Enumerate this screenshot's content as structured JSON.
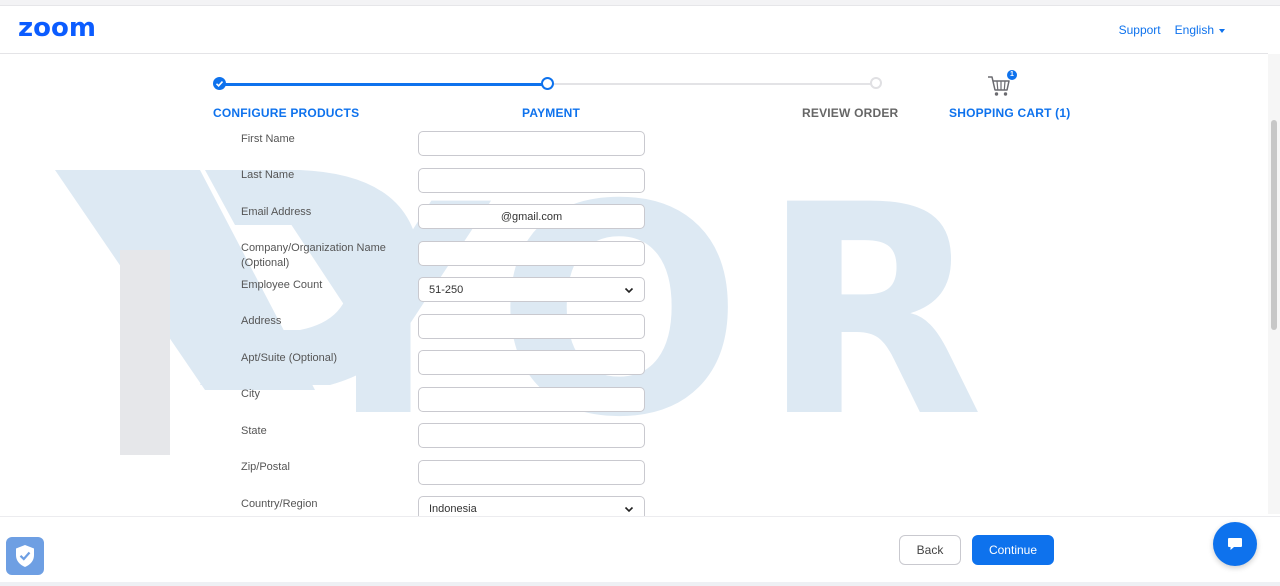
{
  "header": {
    "logo": "zoom",
    "support_label": "Support",
    "language_label": "English"
  },
  "watermark": {
    "text": "YOR"
  },
  "stepper": {
    "steps": [
      {
        "label": "CONFIGURE PRODUCTS",
        "state": "done"
      },
      {
        "label": "PAYMENT",
        "state": "current"
      },
      {
        "label": "REVIEW ORDER",
        "state": "upcoming"
      }
    ],
    "cart_label": "SHOPPING CART (1)",
    "cart_count": "1"
  },
  "form": {
    "first_name": {
      "label": "First Name",
      "value": ""
    },
    "last_name": {
      "label": "Last Name",
      "value": ""
    },
    "email": {
      "label": "Email Address",
      "value": "@gmail.com"
    },
    "company": {
      "label": "Company/Organization Name (Optional)",
      "value": ""
    },
    "employee_count": {
      "label": "Employee Count",
      "value": "51-250"
    },
    "address": {
      "label": "Address",
      "value": ""
    },
    "apt": {
      "label": "Apt/Suite (Optional)",
      "value": ""
    },
    "city": {
      "label": "City",
      "value": ""
    },
    "state": {
      "label": "State",
      "value": ""
    },
    "zip": {
      "label": "Zip/Postal",
      "value": ""
    },
    "country": {
      "label": "Country/Region",
      "value": "Indonesia"
    }
  },
  "footer": {
    "back_label": "Back",
    "continue_label": "Continue"
  },
  "colors": {
    "brand": "#0b5cff",
    "accent": "#0e72ed",
    "watermark": "#dbe9f4"
  },
  "icons": {
    "cart": "shopping-cart-icon",
    "shield": "shield-check-icon",
    "chat": "chat-bubble-icon",
    "chevron": "chevron-down-icon"
  }
}
